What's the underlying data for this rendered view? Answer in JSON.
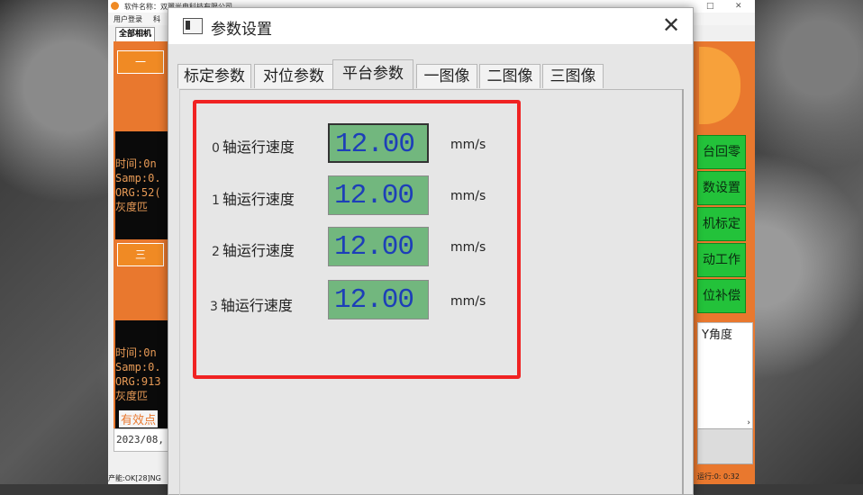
{
  "app": {
    "title": "软件名称：双翼光电科技有限公司",
    "menu": [
      "用户登录",
      "科"
    ],
    "camera_tab": "全部相机",
    "cam1_button": "一",
    "cam3_button": "三",
    "cam1_info": [
      "时间:0n",
      "Samp:0.",
      "ORG:52(",
      "灰度匹"
    ],
    "cam3_info": [
      "时间:0n",
      "Samp:0.",
      "ORG:913",
      "灰度匹"
    ],
    "valid_point": "有效点",
    "date": "2023/08,",
    "status_left": "产能:OK[28]NG",
    "right_buttons": [
      "台回零",
      "数设置",
      "机标定",
      "动工作",
      "位补偿"
    ],
    "right_table_header": "Y角度",
    "right_status": "运行:0: 0:32",
    "brand_color": "#e9782e",
    "green_color": "#23c23a"
  },
  "dialog": {
    "title": "参数设置",
    "close_icon": "close-icon",
    "tabs": [
      "标定参数",
      "对位参数",
      "平台参数",
      "一图像",
      "二图像",
      "三图像"
    ],
    "active_tab": "平台参数",
    "axes": [
      {
        "num": "0",
        "label": "轴运行速度",
        "value": "12.00",
        "unit": "mm/s"
      },
      {
        "num": "1",
        "label": "轴运行速度",
        "value": "12.00",
        "unit": "mm/s"
      },
      {
        "num": "2",
        "label": "轴运行速度",
        "value": "12.00",
        "unit": "mm/s"
      },
      {
        "num": "3",
        "label": "轴运行速度",
        "value": "12.00",
        "unit": "mm/s"
      }
    ],
    "highlight_color": "#f02222",
    "input_bg": "#72b77e",
    "input_text_color": "#1d3fb8"
  }
}
